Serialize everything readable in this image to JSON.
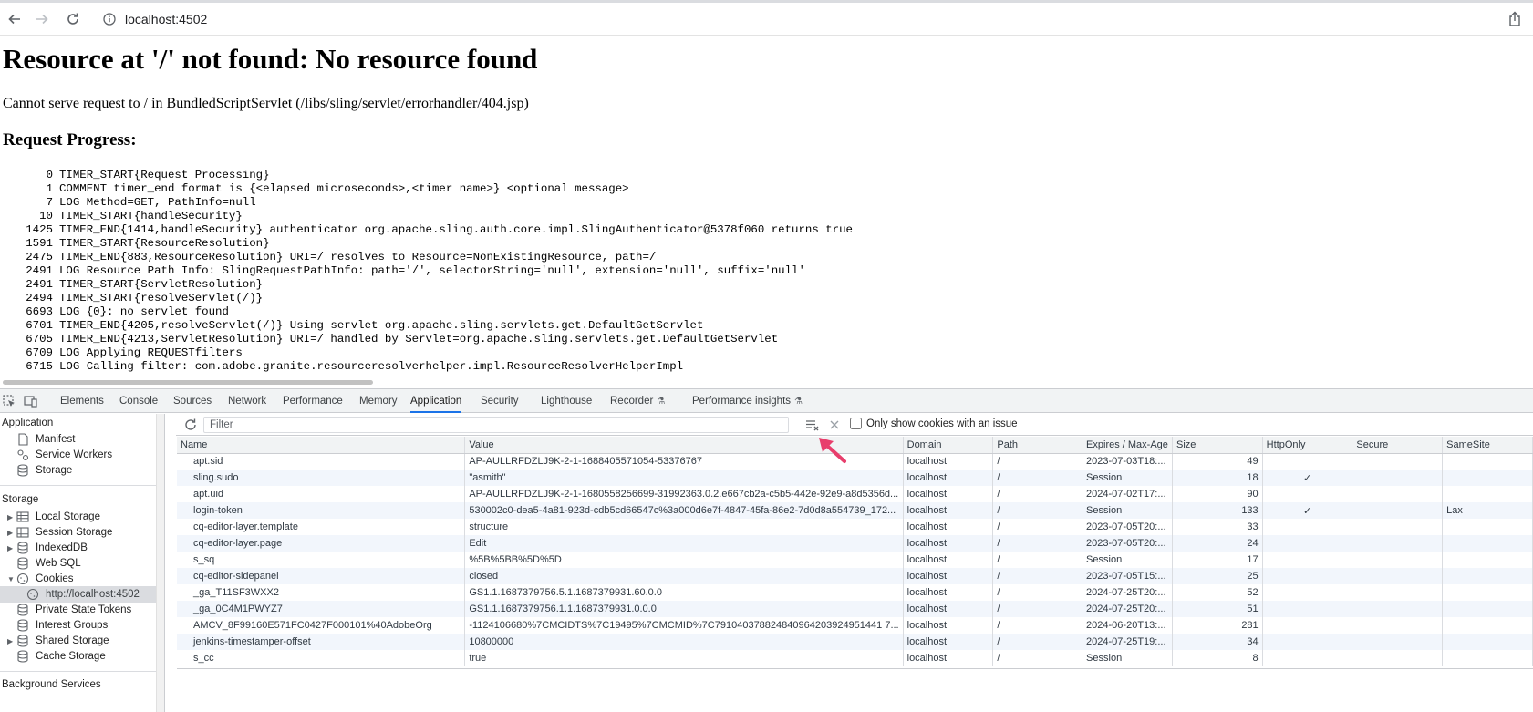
{
  "browser": {
    "url": "localhost:4502"
  },
  "page": {
    "title": "Resource at '/' not found: No resource found",
    "description": "Cannot serve request to / in BundledScriptServlet (/libs/sling/servlet/errorhandler/404.jsp)",
    "progress_heading": "Request Progress:",
    "log": [
      {
        "n": "0",
        "text": "TIMER_START{Request Processing}"
      },
      {
        "n": "1",
        "text": "COMMENT timer_end format is {<elapsed microseconds>,<timer name>} <optional message>"
      },
      {
        "n": "7",
        "text": "LOG Method=GET, PathInfo=null"
      },
      {
        "n": "10",
        "text": "TIMER_START{handleSecurity}"
      },
      {
        "n": "1425",
        "text": "TIMER_END{1414,handleSecurity} authenticator org.apache.sling.auth.core.impl.SlingAuthenticator@5378f060 returns true"
      },
      {
        "n": "1591",
        "text": "TIMER_START{ResourceResolution}"
      },
      {
        "n": "2475",
        "text": "TIMER_END{883,ResourceResolution} URI=/ resolves to Resource=NonExistingResource, path=/"
      },
      {
        "n": "2491",
        "text": "LOG Resource Path Info: SlingRequestPathInfo: path='/', selectorString='null', extension='null', suffix='null'"
      },
      {
        "n": "2491",
        "text": "TIMER_START{ServletResolution}"
      },
      {
        "n": "2494",
        "text": "TIMER_START{resolveServlet(/)}"
      },
      {
        "n": "6693",
        "text": "LOG {0}: no servlet found"
      },
      {
        "n": "6701",
        "text": "TIMER_END{4205,resolveServlet(/)} Using servlet org.apache.sling.servlets.get.DefaultGetServlet"
      },
      {
        "n": "6705",
        "text": "TIMER_END{4213,ServletResolution} URI=/ handled by Servlet=org.apache.sling.servlets.get.DefaultGetServlet"
      },
      {
        "n": "6709",
        "text": "LOG Applying REQUESTfilters"
      },
      {
        "n": "6715",
        "text": "LOG Calling filter: com.adobe.granite.resourceresolverhelper.impl.ResourceResolverHelperImpl"
      }
    ]
  },
  "devtools": {
    "tabs": [
      "Elements",
      "Console",
      "Sources",
      "Network",
      "Performance",
      "Memory",
      "Application",
      "Security",
      "Lighthouse",
      "Recorder",
      "Performance insights"
    ],
    "active_tab": "Application",
    "sidebar": {
      "application_heading": "Application",
      "application_items": [
        "Manifest",
        "Service Workers",
        "Storage"
      ],
      "storage_heading": "Storage",
      "storage_items": [
        "Local Storage",
        "Session Storage",
        "IndexedDB",
        "Web SQL",
        "Cookies"
      ],
      "cookie_origin": "http://localhost:4502",
      "storage_items_after": [
        "Private State Tokens",
        "Interest Groups",
        "Shared Storage",
        "Cache Storage"
      ],
      "background_heading": "Background Services"
    },
    "cookies": {
      "filter_placeholder": "Filter",
      "issue_filter_label": "Only show cookies with an issue",
      "columns": [
        "Name",
        "Value",
        "Domain",
        "Path",
        "Expires / Max-Age",
        "Size",
        "HttpOnly",
        "Secure",
        "SameSite"
      ],
      "rows": [
        {
          "name": "apt.sid",
          "value": "AP-AULLRFDZLJ9K-2-1-1688405571054-53376767",
          "domain": "localhost",
          "path": "/",
          "expires": "2023-07-03T18:...",
          "size": "49",
          "httponly": "",
          "secure": "",
          "samesite": ""
        },
        {
          "name": "sling.sudo",
          "value": "\"asmith\"",
          "domain": "localhost",
          "path": "/",
          "expires": "Session",
          "size": "18",
          "httponly": "✓",
          "secure": "",
          "samesite": ""
        },
        {
          "name": "apt.uid",
          "value": "AP-AULLRFDZLJ9K-2-1-1680558256699-31992363.0.2.e667cb2a-c5b5-442e-92e9-a8d5356d...",
          "domain": "localhost",
          "path": "/",
          "expires": "2024-07-02T17:...",
          "size": "90",
          "httponly": "",
          "secure": "",
          "samesite": ""
        },
        {
          "name": "login-token",
          "value": "530002c0-deа5-4a81-923d-cdb5cd66547c%3a000d6e7f-4847-45fa-86e2-7d0d8a554739_172...",
          "domain": "localhost",
          "path": "/",
          "expires": "Session",
          "size": "133",
          "httponly": "✓",
          "secure": "",
          "samesite": "Lax"
        },
        {
          "name": "cq-editor-layer.template",
          "value": "structure",
          "domain": "localhost",
          "path": "/",
          "expires": "2023-07-05T20:...",
          "size": "33",
          "httponly": "",
          "secure": "",
          "samesite": ""
        },
        {
          "name": "cq-editor-layer.page",
          "value": "Edit",
          "domain": "localhost",
          "path": "/",
          "expires": "2023-07-05T20:...",
          "size": "24",
          "httponly": "",
          "secure": "",
          "samesite": ""
        },
        {
          "name": "s_sq",
          "value": "%5B%5BB%5D%5D",
          "domain": "localhost",
          "path": "/",
          "expires": "Session",
          "size": "17",
          "httponly": "",
          "secure": "",
          "samesite": ""
        },
        {
          "name": "cq-editor-sidepanel",
          "value": "closed",
          "domain": "localhost",
          "path": "/",
          "expires": "2023-07-05T15:...",
          "size": "25",
          "httponly": "",
          "secure": "",
          "samesite": ""
        },
        {
          "name": "_ga_T11SF3WXX2",
          "value": "GS1.1.1687379756.5.1.1687379931.60.0.0",
          "domain": "localhost",
          "path": "/",
          "expires": "2024-07-25T20:...",
          "size": "52",
          "httponly": "",
          "secure": "",
          "samesite": ""
        },
        {
          "name": "_ga_0C4M1PWYZ7",
          "value": "GS1.1.1687379756.1.1.1687379931.0.0.0",
          "domain": "localhost",
          "path": "/",
          "expires": "2024-07-25T20:...",
          "size": "51",
          "httponly": "",
          "secure": "",
          "samesite": ""
        },
        {
          "name": "AMCV_8F99160E571FC0427F000101%40AdobeOrg",
          "value": "-1124106680%7CMCIDTS%7C19495%7CMCMID%7C791040378824840964203924951441 7...",
          "domain": "localhost",
          "path": "/",
          "expires": "2024-06-20T13:...",
          "size": "281",
          "httponly": "",
          "secure": "",
          "samesite": ""
        },
        {
          "name": "jenkins-timestamper-offset",
          "value": "10800000",
          "domain": "localhost",
          "path": "/",
          "expires": "2024-07-25T19:...",
          "size": "34",
          "httponly": "",
          "secure": "",
          "samesite": ""
        },
        {
          "name": "s_cc",
          "value": "true",
          "domain": "localhost",
          "path": "/",
          "expires": "Session",
          "size": "8",
          "httponly": "",
          "secure": "",
          "samesite": ""
        }
      ]
    }
  },
  "colors": {
    "accent": "#1a73e8",
    "annotation_arrow": "#e83e6c",
    "row_alt": "#f2f6fc"
  }
}
